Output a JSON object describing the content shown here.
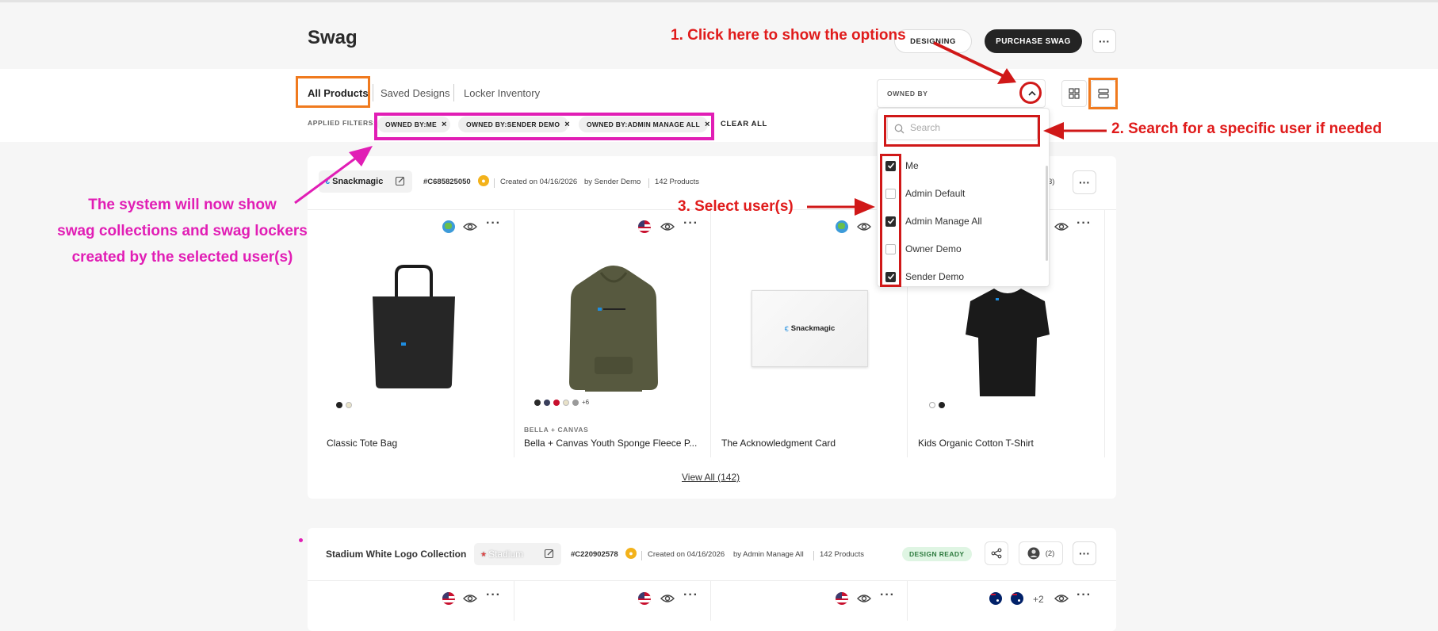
{
  "header": {
    "title": "Swag",
    "design_button": "DESIGNING",
    "purchase_button": "PURCHASE SWAG"
  },
  "tabs": [
    {
      "label": "All Products"
    },
    {
      "label": "Saved Designs"
    },
    {
      "label": "Locker Inventory"
    }
  ],
  "filters": {
    "label": "APPLIED FILTERS:",
    "chips": [
      "OWNED BY:ME",
      "OWNED BY:SENDER DEMO",
      "OWNED BY:ADMIN MANAGE ALL"
    ],
    "clear_all": "CLEAR ALL"
  },
  "owned_by": {
    "label": "OWNED BY",
    "search_placeholder": "Search",
    "options": [
      {
        "label": "Me",
        "checked": true
      },
      {
        "label": "Admin Default",
        "checked": false
      },
      {
        "label": "Admin Manage All",
        "checked": true
      },
      {
        "label": "Owner Demo",
        "checked": false
      },
      {
        "label": "Sender Demo",
        "checked": true
      }
    ]
  },
  "collection1": {
    "brand": "Snackmagic",
    "id": "#C685825050",
    "created": "Created on 04/16/2026",
    "by": "by Sender Demo",
    "count": "142 Products",
    "members_partial": "3)",
    "products": [
      {
        "brand": "",
        "name": "Classic Tote Bag"
      },
      {
        "brand": "BELLA + CANVAS",
        "name": "Bella + Canvas Youth Sponge Fleece P...",
        "extra_colors": "+6"
      },
      {
        "brand": "",
        "name": "The Acknowledgment Card",
        "card_logo": "Snackmagic"
      },
      {
        "brand": "",
        "name": "Kids Organic Cotton T-Shirt"
      }
    ],
    "view_all": "View All (142)"
  },
  "collection2": {
    "name": "Stadium White Logo Collection",
    "brand": "Stadium",
    "id": "#C220902578",
    "created": "Created on 04/16/2026",
    "by": "by Admin Manage All",
    "count": "142 Products",
    "status": "DESIGN READY",
    "members": "(2)",
    "flag_extra": "+2"
  },
  "annotations": {
    "step1": "1. Click here to show the options",
    "step2": "2. Search for a specific user if needed",
    "step3": "3. Select user(s)",
    "result_line1": "The system will now show",
    "result_line2": "swag collections and swag lockers",
    "result_line3": "created by the selected user(s)"
  },
  "colors": {
    "annotation_red": "#e01b1b",
    "annotation_pink": "#e11eb5",
    "highlight_orange": "#f07a1e",
    "badge_green_bg": "#dff5e3"
  }
}
